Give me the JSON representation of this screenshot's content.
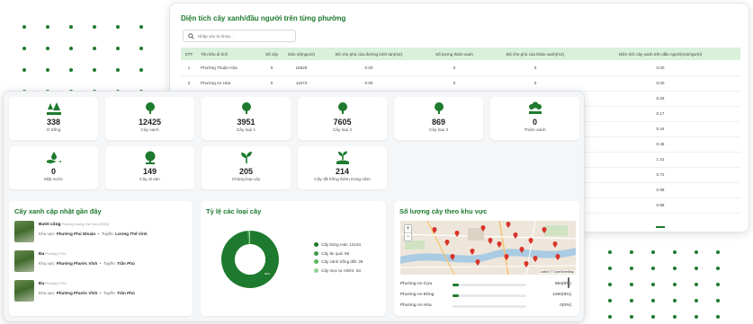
{
  "back_window": {
    "title": "Diện tích cây xanh/đầu người trên từng phường",
    "search": {
      "placeholder": "Nhập vào từ khóa..."
    },
    "columns": [
      "STT",
      "Tên khu di tích",
      "Số cây",
      "Dân số(người)",
      "Độ che phủ của đường kính tán(m2)",
      "Số lượng thảm xanh",
      "Độ che phủ của thảm xanh(m2)",
      "Diện tích cây xanh trên đầu người(m2/người)"
    ],
    "rows": [
      [
        "1",
        "Phường Thuận Hòa",
        "0",
        "16528",
        "0.00",
        "0",
        "0",
        "0.00"
      ],
      [
        "2",
        "Phường An Hòa",
        "0",
        "11973",
        "0.00",
        "0",
        "0",
        "0.00"
      ],
      [
        "",
        "",
        "",
        "",
        "",
        "",
        "",
        "6.26"
      ],
      [
        "",
        "",
        "",
        "",
        "",
        "",
        "",
        "0.17"
      ],
      [
        "",
        "",
        "",
        "",
        "",
        "",
        "",
        "0.44"
      ],
      [
        "",
        "",
        "",
        "",
        "",
        "",
        "",
        "0.45"
      ],
      [
        "",
        "",
        "",
        "",
        "",
        "",
        "",
        "1.31"
      ],
      [
        "",
        "",
        "",
        "",
        "",
        "",
        "",
        "0.72"
      ],
      [
        "",
        "",
        "",
        "",
        "",
        "",
        "",
        "0.98"
      ],
      [
        "",
        "",
        "",
        "",
        "",
        "",
        "",
        "0.88"
      ]
    ]
  },
  "stats": [
    {
      "value": "338",
      "label": "Ô trống",
      "icon": "forest-icon"
    },
    {
      "value": "12425",
      "label": "Cây xanh",
      "icon": "tree-icon"
    },
    {
      "value": "3951",
      "label": "Cây loại 1",
      "icon": "tree-icon"
    },
    {
      "value": "7605",
      "label": "Cây loại 2",
      "icon": "tree-icon"
    },
    {
      "value": "869",
      "label": "Cây loại 3",
      "icon": "tree-icon"
    },
    {
      "value": "0",
      "label": "Thảm xanh",
      "icon": "shrubs-icon"
    },
    {
      "value": "0",
      "label": "Mặt nước",
      "icon": "water-icon"
    },
    {
      "value": "149",
      "label": "Cây di sản",
      "icon": "heritage-tree-icon"
    },
    {
      "value": "205",
      "label": "Chủng loại cây",
      "icon": "sprout-icon"
    },
    {
      "value": "214",
      "label": "Cây đã trồng thêm trong năm",
      "icon": "planting-icon"
    }
  ],
  "recent": {
    "title": "Cây xanh cập nhật gần đây",
    "area_label": "Khu vực:",
    "route_label": "Tuyến:",
    "items": [
      {
        "name": "Bưởi cổng",
        "time": "Phường Lương Thế Vinh (25/03)",
        "area": "Phường Phú Nhuận",
        "route": "Lương Thế Vinh"
      },
      {
        "name": "Đa",
        "time": "Phường 07/04",
        "area": "Phường Phước Vĩnh",
        "route": "Trần Phú"
      },
      {
        "name": "Đa",
        "time": "Phường 07/04",
        "area": "Phường Phước Vĩnh",
        "route": "Trần Phú"
      }
    ]
  },
  "ratio": {
    "title": "Tỷ lệ các loại cây",
    "center_label": "99%",
    "legend": [
      {
        "label": "Cây bóng mát: 12104",
        "value": 12104,
        "color": "#1e7a2e"
      },
      {
        "label": "Cây ăn quả: 96",
        "value": 96,
        "color": "#3f9a48"
      },
      {
        "label": "Cây cảnh trồng đất: 28",
        "value": 28,
        "color": "#5cb85c"
      },
      {
        "label": "Cây mọc tự nhiên: 53",
        "value": 53,
        "color": "#8fd18f"
      }
    ]
  },
  "area_count": {
    "title": "Số lượng cây theo khu vực",
    "map_attribution": "Leaflet | © OpenStreetMap",
    "zoom_in": "+",
    "zoom_out": "−",
    "rows": [
      {
        "name": "Phường An Cựu",
        "value": "984(8%)",
        "fraction": 0.08
      },
      {
        "name": "Phường An Đông",
        "value": "1060(9%)",
        "fraction": 0.09
      },
      {
        "name": "Phường An Hòa",
        "value": "0(0%)",
        "fraction": 0.0
      }
    ]
  }
}
